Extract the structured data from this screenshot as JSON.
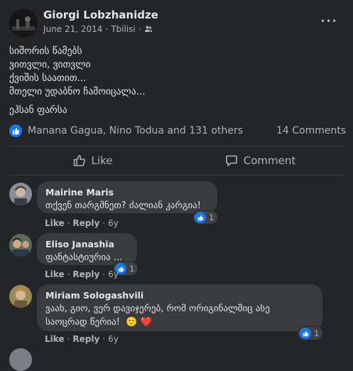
{
  "post": {
    "author": "Giorgi Lobzhanidze",
    "date": "June 21, 2014",
    "separator": "·",
    "location": "Tbilisi",
    "privacy_icon": "friends-icon",
    "more_label": "•••",
    "body_lines": [
      "სიშორის წამებს",
      "ვითვლი, ვითვლი",
      "ქვიშის საათით...",
      "მთელი უდაბნო ჩამოიცალა..."
    ],
    "signature": "ეჰსან ფარსა",
    "reactions": {
      "icon": "like-icon",
      "text": "Manana Gagua, Nino Todua and 131 others",
      "comments": "14 Comments"
    },
    "actions": {
      "like": "Like",
      "comment": "Comment"
    }
  },
  "comments": [
    {
      "author": "Mairine Maris",
      "lines": [
        "თქვენ თარგმნეთ? ძალიან კარგია!"
      ],
      "like": "Like",
      "dot": "·",
      "reply": "Reply",
      "time": "6y",
      "reaction_count": "1"
    },
    {
      "author": "Eliso Janashia",
      "lines": [
        "ფანტასტიურია ..."
      ],
      "like": "Like",
      "dot": "·",
      "reply": "Reply",
      "time": "6y",
      "reaction_count": "1"
    },
    {
      "author": "Miriam Sologashvili",
      "lines": [
        "ვაახ, გიო, ვერ დავიჯერებ, რომ ორიგინალშიც ასე",
        "საოცრად წერია!"
      ],
      "emoji": "🙂 ❤️",
      "like": "Like",
      "dot": "·",
      "reply": "Reply",
      "time": "6y",
      "reaction_count": "1"
    }
  ]
}
